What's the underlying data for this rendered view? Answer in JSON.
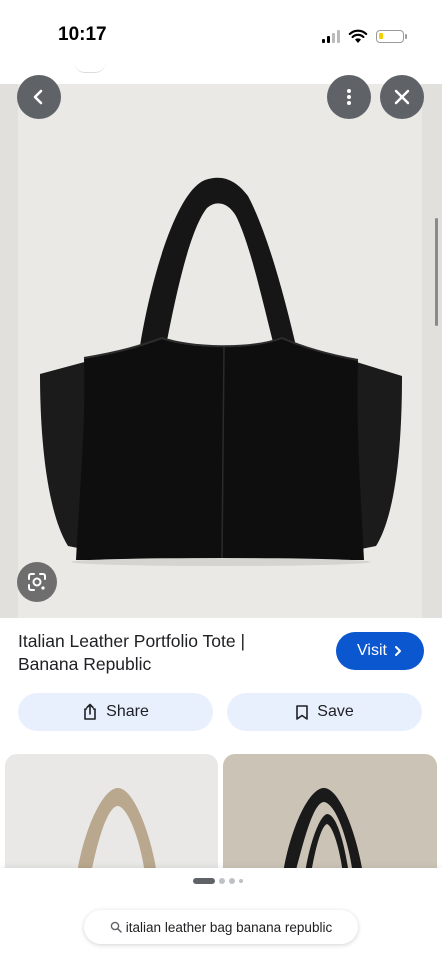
{
  "status_bar": {
    "time": "10:17",
    "battery_level": 0.2,
    "battery_color": "#f5d000"
  },
  "image_viewer": {
    "back_icon": "chevron-left-icon",
    "more_icon": "more-vertical-icon",
    "close_icon": "close-icon",
    "lens_icon": "google-lens-icon"
  },
  "product": {
    "title": "Italian Leather Portfolio Tote | Banana Republic"
  },
  "actions": {
    "visit_label": "Visit",
    "visit_icon": "chevron-right-icon",
    "visit_color": "#0b57d0",
    "share_label": "Share",
    "share_icon": "share-icon",
    "save_label": "Save",
    "save_icon": "bookmark-icon",
    "action_bg_color": "#e8f0fe"
  },
  "related_results": [
    {
      "thumbnail": "tan-tote-bag-image"
    },
    {
      "thumbnail": "black-tote-bag-image"
    }
  ],
  "bottom_bar": {
    "search_query": "italian leather bag banana republic",
    "search_icon": "search-icon"
  }
}
